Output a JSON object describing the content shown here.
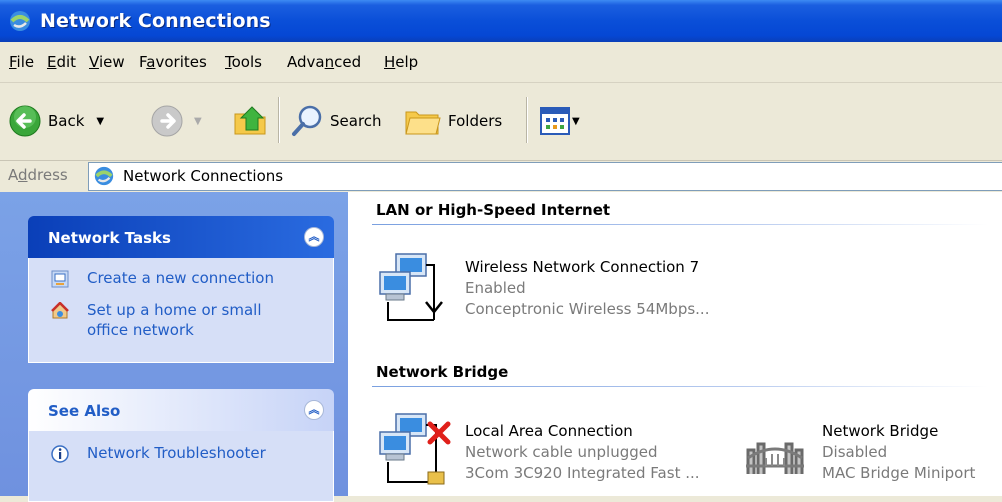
{
  "window": {
    "title": "Network Connections"
  },
  "menu": {
    "items": [
      {
        "label": "File"
      },
      {
        "label": "Edit"
      },
      {
        "label": "View"
      },
      {
        "label": "Favorites"
      },
      {
        "label": "Tools"
      },
      {
        "label": "Advanced"
      },
      {
        "label": "Help"
      }
    ]
  },
  "toolbar": {
    "back_label": "Back",
    "search_label": "Search",
    "folders_label": "Folders"
  },
  "address": {
    "label": "Address",
    "value": "Network Connections"
  },
  "sidebar": {
    "network_tasks": {
      "title": "Network Tasks",
      "items": [
        {
          "label": "Create a new connection",
          "icon": "new-connection-icon"
        },
        {
          "label_line1": "Set up a home or small",
          "label_line2": "office network",
          "icon": "home-network-icon"
        }
      ]
    },
    "see_also": {
      "title": "See Also",
      "items": [
        {
          "label": "Network Troubleshooter",
          "icon": "info-icon"
        }
      ]
    }
  },
  "groups": [
    {
      "title": "LAN or High-Speed Internet",
      "items": [
        {
          "name": "Wireless Network Connection 7",
          "status": "Enabled",
          "device": "Conceptronic Wireless 54Mbps..."
        }
      ]
    },
    {
      "title": "Network Bridge",
      "items": [
        {
          "name": "Local Area Connection",
          "status": "Network cable unplugged",
          "device": "3Com 3C920 Integrated Fast ..."
        },
        {
          "name": "Network Bridge",
          "status": "Disabled",
          "device": "MAC Bridge Miniport"
        }
      ]
    }
  ],
  "colors": {
    "titlebar": "#0a4fd8",
    "link": "#215dc6",
    "sidebar_bg": "#7ba2e7",
    "panel_bg": "#d6dff7",
    "unplugged": "#e0201a"
  }
}
